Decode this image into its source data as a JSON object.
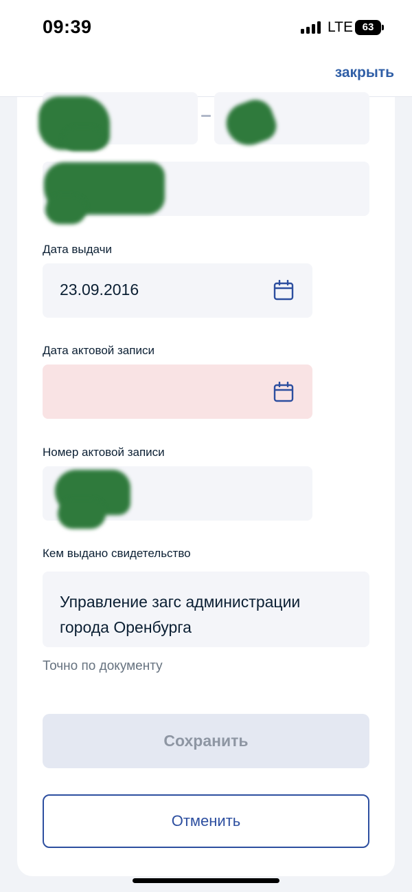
{
  "status_bar": {
    "time": "09:39",
    "network": "LTE",
    "battery": "63"
  },
  "header": {
    "close_label": "закрыть"
  },
  "form": {
    "issue_date": {
      "label": "Дата выдачи",
      "value": "23.09.2016"
    },
    "record_date": {
      "label": "Дата актовой записи",
      "value": ""
    },
    "record_number": {
      "label": "Номер актовой записи"
    },
    "issued_by": {
      "label": "Кем выдано свидетельство",
      "value_line1": "Управление загс администрации",
      "value_line2": "города Оренбурга",
      "hint": "Точно по документу"
    }
  },
  "actions": {
    "save_label": "Сохранить",
    "cancel_label": "Отменить"
  },
  "colors": {
    "accent": "#2c4e9f",
    "link": "#2f5ea6",
    "error_field": "#f9e3e4",
    "field": "#f4f5f9",
    "redaction": "#2f7a3c"
  },
  "icons": [
    "signal-icon",
    "battery-icon",
    "calendar-icon"
  ]
}
